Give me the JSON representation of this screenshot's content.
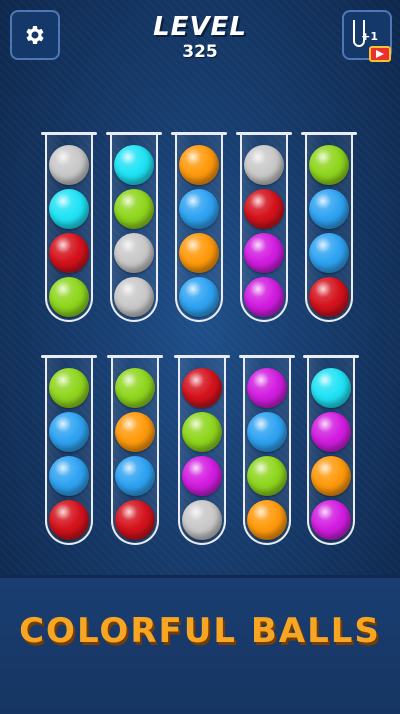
{
  "header": {
    "level_label": "LEVEL",
    "level_number": "325",
    "settings_icon": "gear-icon",
    "add_tube_badge": "+1",
    "add_tube_icon": "empty-tube-icon",
    "video_icon": "video-ad-icon"
  },
  "colors": {
    "gray": "#c9c9c9",
    "cyan": "#1fe3f5",
    "red": "#d4121c",
    "lime": "#8fd61e",
    "orange": "#ff9a0c",
    "blue": "#2fa3f2",
    "magenta": "#d21de0"
  },
  "tubes_top": [
    [
      "gray",
      "cyan",
      "red",
      "lime"
    ],
    [
      "cyan",
      "lime",
      "gray",
      "gray"
    ],
    [
      "orange",
      "blue",
      "orange",
      "blue"
    ],
    [
      "gray",
      "red",
      "magenta",
      "magenta"
    ],
    [
      "lime",
      "blue",
      "blue",
      "red"
    ]
  ],
  "tubes_bottom": [
    [
      "lime",
      "blue",
      "blue",
      "red"
    ],
    [
      "lime",
      "orange",
      "blue",
      "red"
    ],
    [
      "red",
      "lime",
      "magenta",
      "gray"
    ],
    [
      "magenta",
      "blue",
      "lime",
      "orange"
    ],
    [
      "cyan",
      "magenta",
      "orange",
      "magenta"
    ]
  ],
  "banner": {
    "title": "COLORFUL BALLS"
  }
}
